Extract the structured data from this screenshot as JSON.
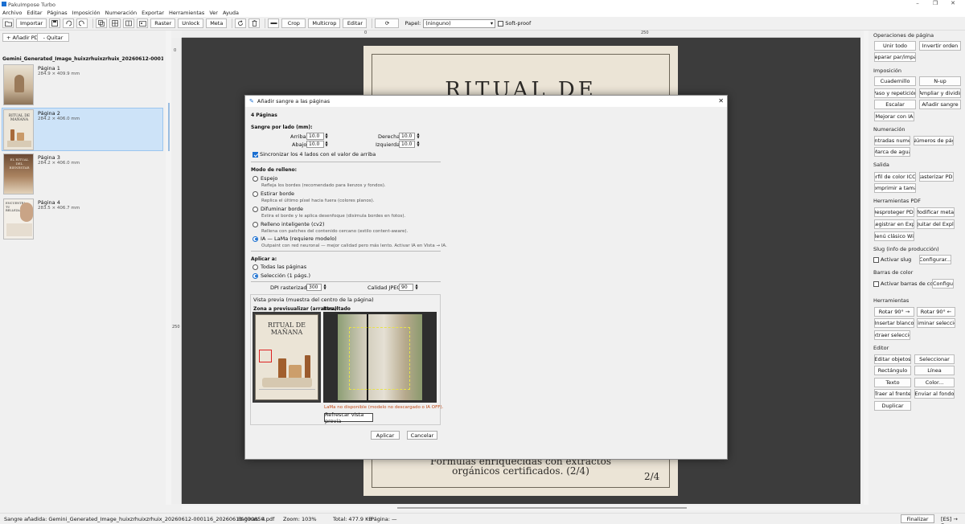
{
  "window": {
    "title": "PakuImpose Turbo",
    "controls": [
      "–",
      "❐",
      "✕"
    ]
  },
  "menu": [
    "Archivo",
    "Editar",
    "Páginas",
    "Imposición",
    "Numeración",
    "Exportar",
    "Herramientas",
    "Ver",
    "Ayuda"
  ],
  "toolbar": {
    "importar": "Importar",
    "raster": "Raster",
    "unlock": "Unlock",
    "meta": "Meta",
    "crop": "Crop",
    "multicrop": "Multicrop",
    "editar": "Editar",
    "papel_label": "Papel:",
    "papel_value": "(ninguno)",
    "softproof": "Soft-proof"
  },
  "left": {
    "add_pdf": "+ Añadir PDF",
    "remove": "- Quitar",
    "file": "Gemini_Generated_Image_huixzrhuixzrhuix_20260612-000116.pdf",
    "pages": [
      {
        "label": "Página 1",
        "dims": "284.9 × 409.9 mm"
      },
      {
        "label": "Página 2",
        "dims": "284.2 × 406.0 mm"
      },
      {
        "label": "Página 3",
        "dims": "284.2 × 406.0 mm"
      },
      {
        "label": "Página 4",
        "dims": "283.5 × 406.7 mm"
      }
    ],
    "thumb1_text": "",
    "thumb2_text": "RITUAL DE MAÑANA",
    "thumb3_text": "EL RITUAL DEL BIENESTAR",
    "thumb4_text": "ENCUENTRA TU BELLEZA"
  },
  "canvas": {
    "ruler_top": [
      "0",
      "250"
    ],
    "ruler_left": [
      "0",
      "250"
    ],
    "page_title": "RITUAL DE",
    "page_line1": "Fórmulas enriquecidas con extractos",
    "page_line2": "orgánicos certificados. (2/4)",
    "page_num": "2/4"
  },
  "dialog": {
    "title": "Añadir sangre a las páginas",
    "count": "4 Páginas",
    "bleed_header": "Sangre por lado (mm):",
    "arriba_label": "Arriba:",
    "arriba": "10.0",
    "abajo_label": "Abajo:",
    "abajo": "10.0",
    "derecha_label": "Derecha:",
    "derecha": "10.0",
    "izquierda_label": "Izquierda:",
    "izquierda": "10.0",
    "sync": "Sincronizar los 4 lados con el valor de arriba",
    "fill_header": "Modo de relleno:",
    "modes": [
      {
        "name": "Espejo",
        "hint": "Refleja los bordes (recomendado para lienzos y fondos)."
      },
      {
        "name": "Estirar borde",
        "hint": "Replica el último píxel hacia fuera (colores planos)."
      },
      {
        "name": "Difuminar borde",
        "hint": "Estira el borde y le aplica desenfoque (disimula bordes en fotos)."
      },
      {
        "name": "Relleno inteligente (cv2)",
        "hint": "Rellena con patches del contenido cercano (estilo content-aware)."
      },
      {
        "name": "IA — LaMa (requiere modelo)",
        "hint": "Outpaint con red neuronal — mejor calidad pero más lento. Activar IA en Vista → IA."
      }
    ],
    "apply_header": "Aplicar a:",
    "apply_all": "Todas las páginas",
    "apply_sel": "Selección (1 págs.)",
    "dpi_label": "DPI rasterizado:",
    "dpi": "300",
    "jpeg_label": "Calidad JPEG:",
    "jpeg": "90",
    "preview_header": "Vista previa (muestra del centro de la página)",
    "zone_label": "Zona a previsualizar (arrastra)",
    "result_label": "Resultado",
    "preview_title": "RITUAL DE MAÑANA",
    "lama_msg": "LaMa no disponible (modelo no descargado o IA OFF).",
    "refresh": "Refrescar vista previa",
    "apply": "Aplicar",
    "cancel": "Cancelar"
  },
  "right": {
    "sections": {
      "ops": "Operaciones de página",
      "impo": "Imposición",
      "num": "Numeración",
      "salida": "Salida",
      "pdf": "Herramientas PDF",
      "slug": "Slug (info de producción)",
      "barras": "Barras de color",
      "herr": "Herramientas",
      "editor": "Editor"
    },
    "unir": "Unir todo",
    "invertir": "Invertir orden",
    "separar": "Separar par/impar",
    "cuadernillo": "Cuadernillo",
    "nup": "N-up",
    "paso": "Paso y repetición",
    "ampliar": "Ampliar y dividir",
    "escalar": "Escalar",
    "anadir_sangre": "Añadir sangre",
    "mejorar": "Mejorar con IA",
    "entradas": "Entradas numer",
    "numeros": "Números de pág",
    "marca": "Marca de agua",
    "perfil": "Perfil de color ICC...",
    "rasterizar": "Rasterizar PDF",
    "comprimir": "Comprimir a tamañ",
    "desproteger": "Desproteger PDF",
    "modificar": "Modificar metac",
    "registrar": "Registrar en Expl",
    "quitar_expl": "Quitar del Explc",
    "menu_clasico": "Menú clásico Win",
    "activar_slug": "Activar slug",
    "configurar": "Configurar...",
    "activar_barras": "Activar barras de color",
    "configu": "Configu",
    "rotar_der": "Rotar 90° →",
    "rotar_izq": "Rotar 90° ←",
    "insertar": "Insertar blanco",
    "eliminar": "Eliminar selecciór",
    "extraer": "Extraer selecciór",
    "editar_obj": "Editar objetos",
    "seleccionar": "Seleccionar",
    "rectangulo": "Rectángulo",
    "linea": "Línea",
    "texto": "Texto",
    "color": "Color...",
    "traer": "Traer al frente",
    "enviar": "Enviar al fondo",
    "duplicar": "Duplicar"
  },
  "status": {
    "msg": "Sangre añadida: Gemini_Generated_Image_huixzrhuixzrhuix_20260612-000116_20260612-000850.pdf",
    "paginas": "Páginas: 4",
    "zoom": "Zoom: 103%",
    "total": "Total: 477.9 KB",
    "pagina": "· Página: —",
    "finalizar": "Finalizar",
    "lang": "[ES] → En"
  }
}
